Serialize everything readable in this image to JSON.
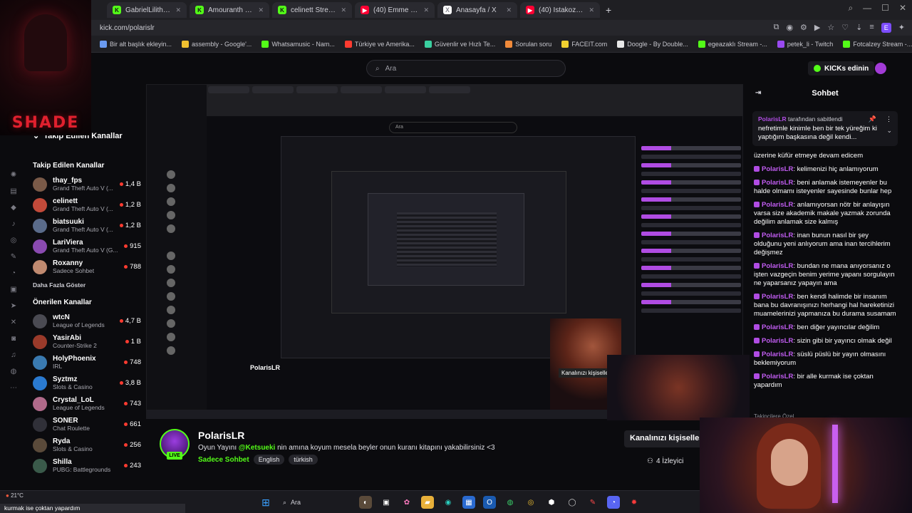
{
  "browser": {
    "tabs": [
      {
        "label": "GabrielLilith Stream - W",
        "icon": "kick"
      },
      {
        "label": "Amouranth Stream - Wa",
        "icon": "kick"
      },
      {
        "label": "celinett Stream - Watch",
        "icon": "kick"
      },
      {
        "label": "(40) Emme Ya \"Hemhen",
        "icon": "yt"
      },
      {
        "label": "Anasayfa / X",
        "icon": "x"
      },
      {
        "label": "(40) Istakoz - YouT",
        "icon": "yt"
      }
    ],
    "url": "kick.com/polarislr",
    "bookmarks": [
      "Bir alt başlık ekleyin...",
      "assembly - Google'...",
      "Whatsamusic - Nam...",
      "Türkiye ve Amerika...",
      "Güvenlir ve Hızlı Te...",
      "Sorulan soru",
      "FACEIT.com",
      "Doogle - By Double...",
      "egeazaklı Stream -...",
      "petek_li - Twitch",
      "Fotcalzey Stream -..."
    ]
  },
  "overlay": {
    "cam_text": "SHADE"
  },
  "header": {
    "search_placeholder": "Ara",
    "kicks_label": "KICKs edinin"
  },
  "sidebar": {
    "followed_header": "Takip Edilen Kanallar",
    "followed_section": "Takip Edilen Kanallar",
    "followed": [
      {
        "name": "thay_fps",
        "game": "Grand Theft Auto V (...",
        "viewers": "1,4 B",
        "color": "#7a5a48"
      },
      {
        "name": "celinett",
        "game": "Grand Theft Auto V (...",
        "viewers": "1,2 B",
        "color": "#c24a3a"
      },
      {
        "name": "biatsuuki",
        "game": "Grand Theft Auto V (...",
        "viewers": "1,2 B",
        "color": "#5a6b8a"
      },
      {
        "name": "LariViera",
        "game": "Grand Theft Auto V (G...",
        "viewers": "915",
        "color": "#8a4ab0"
      },
      {
        "name": "Roxanny",
        "game": "Sadece Sohbet",
        "viewers": "788",
        "color": "#c08a70"
      }
    ],
    "show_more": "Daha Fazla Göster",
    "recommended_section": "Önerilen Kanallar",
    "recommended": [
      {
        "name": "wtcN",
        "game": "League of Legends",
        "viewers": "4,7 B",
        "color": "#4a4a52"
      },
      {
        "name": "YasirAbi",
        "game": "Counter-Strike 2",
        "viewers": "1 B",
        "color": "#9a3a2a"
      },
      {
        "name": "HolyPhoenix",
        "game": "IRL",
        "viewers": "748",
        "color": "#3a7ab0"
      },
      {
        "name": "Syztmz",
        "game": "Slots & Casino",
        "viewers": "3,8 B",
        "color": "#2a7ad0"
      },
      {
        "name": "Crystal_LoL",
        "game": "League of Legends",
        "viewers": "743",
        "color": "#b06a8a"
      },
      {
        "name": "SONER",
        "game": "Chat Roulette",
        "viewers": "661",
        "color": "#303038"
      },
      {
        "name": "Ryda",
        "game": "Slots & Casino",
        "viewers": "256",
        "color": "#5a4a3a"
      },
      {
        "name": "Shilla",
        "game": "PUBG: Battlegrounds",
        "viewers": "243",
        "color": "#3a5a4a"
      }
    ]
  },
  "stream": {
    "name": "PolarisLR",
    "live": "LIVE",
    "title_pre": "Oyun  Yayını",
    "mention": "@Ketsueki",
    "title_post": " nin  amına koyum  mesela beyler onun kuranı kitapını yakabilirsiniz <3",
    "category": "Sadece Sohbet",
    "tags": [
      "English",
      "türkish"
    ],
    "customize_label": "Kanalınızı kişiselleştirin",
    "viewers": "4 İzleyici"
  },
  "chat": {
    "title": "Sohbet",
    "pinned": {
      "user": "PolarisLR",
      "suffix": " tarafından sabitlendi",
      "text": "nefretimle kinimle ben bir tek yüreğim ki yaptığım başkasına değil kendi..."
    },
    "messages": [
      {
        "user": "PolarisLR",
        "text": "üzerine küfür etmeye devam edicem"
      },
      {
        "user": "PolarisLR",
        "text": "kelimenizi hiç anlamıyorum"
      },
      {
        "user": "PolarisLR",
        "text": "beni anlamak istemeyenler bu halde olmamı isteyenler sayesinde bunlar hep"
      },
      {
        "user": "PolarisLR",
        "text": "anlamıyorsan nötr bir anlayışın varsa size akademik makale yazmak zorunda değilim anlamak size kalmış"
      },
      {
        "user": "PolarisLR",
        "text": "inan bunun nasıl bir şey olduğunu yeni anlıyorum ama inan tercihlerim değişmez"
      },
      {
        "user": "PolarisLR",
        "text": "bundan ne mana anıyorsanız o işten vazgeçin benim yerime yapanı sorgulayın ne yaparsanız yapayın ama"
      },
      {
        "user": "PolarisLR",
        "text": "ben kendi halimde bir insanım bana bu davranışınızı herhangi hal hareketinizi muamelerinizi yapmanıza bu durama susamam"
      },
      {
        "user": "PolarisLR",
        "text": "ben diğer yayıncılar değilim"
      },
      {
        "user": "PolarisLR",
        "text": "sizin gibi bir yayıncı olmak değil"
      },
      {
        "user": "PolarisLR",
        "text": "süslü püslü bir yayın olmasını beklemiyorum"
      },
      {
        "user": "PolarisLR",
        "text": "bir alle kurmak ise çoktan yapardım"
      }
    ],
    "footer": "Takipçilere Özel"
  },
  "taskbar": {
    "weather": "21°C",
    "notification": "kurmak ise çoktan yapardım",
    "search_label": "Ara"
  }
}
